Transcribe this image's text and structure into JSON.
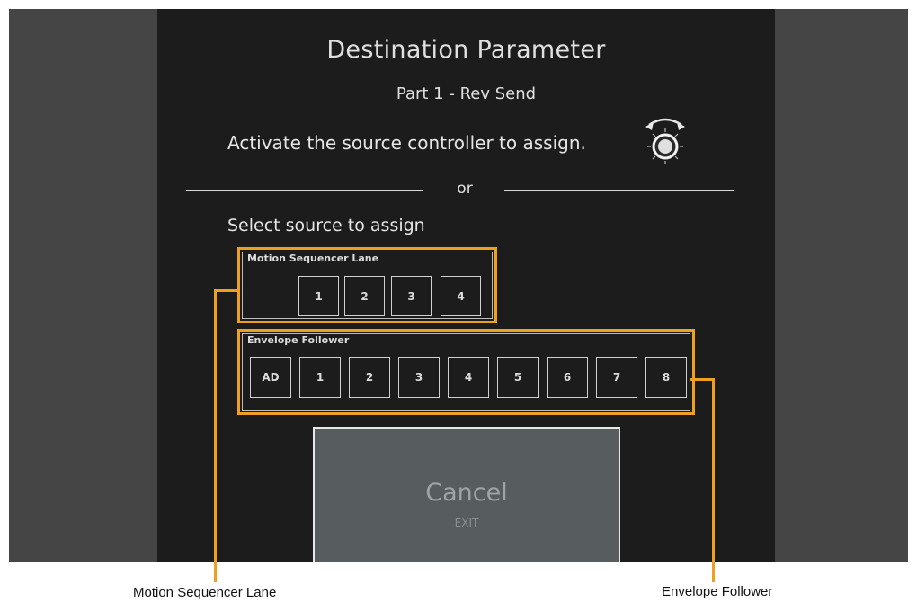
{
  "dialog": {
    "title": "Destination Parameter",
    "subtitle": "Part 1 - Rev Send",
    "activate_text": "Activate the source controller to assign.",
    "or_text": "or",
    "select_title": "Select source to assign",
    "knob_icon": "rotary-knob-icon"
  },
  "motion_sequencer": {
    "label": "Motion Sequencer Lane",
    "buttons": [
      "1",
      "2",
      "3",
      "4"
    ]
  },
  "envelope_follower": {
    "label": "Envelope Follower",
    "buttons": [
      "AD",
      "1",
      "2",
      "3",
      "4",
      "5",
      "6",
      "7",
      "8"
    ]
  },
  "cancel": {
    "label": "Cancel",
    "sub_label": "EXIT"
  },
  "callouts": {
    "motion_sequencer": "Motion Sequencer Lane",
    "envelope_follower": "Envelope Follower"
  },
  "colors": {
    "accent": "#f0a020",
    "screen_bg": "#1c1c1c",
    "panel_bg": "#454545",
    "cancel_bg": "#575c5e"
  }
}
